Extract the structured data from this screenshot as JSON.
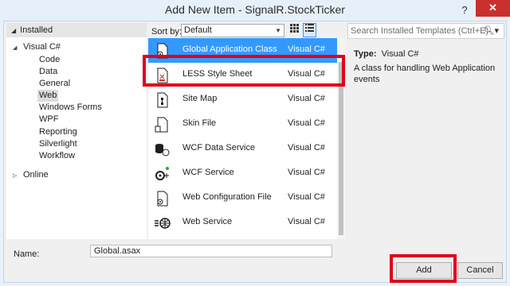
{
  "window": {
    "title": "Add New Item - SignalR.StockTicker",
    "help_glyph": "?",
    "close_glyph": "✕"
  },
  "tree": {
    "header": "Installed",
    "root": "Visual C#",
    "children": [
      "Code",
      "Data",
      "General",
      "Web",
      "Windows Forms",
      "WPF",
      "Reporting",
      "Silverlight",
      "Workflow"
    ],
    "selected": "Web",
    "online": "Online"
  },
  "toolbar": {
    "sort_label": "Sort by:",
    "sort_value": "Default",
    "search_placeholder": "Search Installed Templates (Ctrl+E)"
  },
  "templates": [
    {
      "name": "Global Application Class",
      "lang": "Visual C#",
      "icon": "global-app-icon",
      "selected": true
    },
    {
      "name": "LESS Style Sheet",
      "lang": "Visual C#",
      "icon": "less-sheet-icon"
    },
    {
      "name": "Site Map",
      "lang": "Visual C#",
      "icon": "sitemap-icon"
    },
    {
      "name": "Skin File",
      "lang": "Visual C#",
      "icon": "skin-file-icon"
    },
    {
      "name": "WCF Data Service",
      "lang": "Visual C#",
      "icon": "wcf-data-service-icon"
    },
    {
      "name": "WCF Service",
      "lang": "Visual C#",
      "icon": "wcf-service-icon"
    },
    {
      "name": "Web Configuration File",
      "lang": "Visual C#",
      "icon": "web-config-icon"
    },
    {
      "name": "Web Service",
      "lang": "Visual C#",
      "icon": "web-service-icon"
    }
  ],
  "details": {
    "type_label": "Type:",
    "type_value": "Visual C#",
    "description": "A class for handling Web Application events"
  },
  "form": {
    "name_label": "Name:",
    "name_value": "Global.asax"
  },
  "buttons": {
    "add": "Add",
    "cancel": "Cancel"
  },
  "colors": {
    "selection": "#3399ff",
    "highlight_box": "#e0001b",
    "close_button": "#c9302c"
  }
}
